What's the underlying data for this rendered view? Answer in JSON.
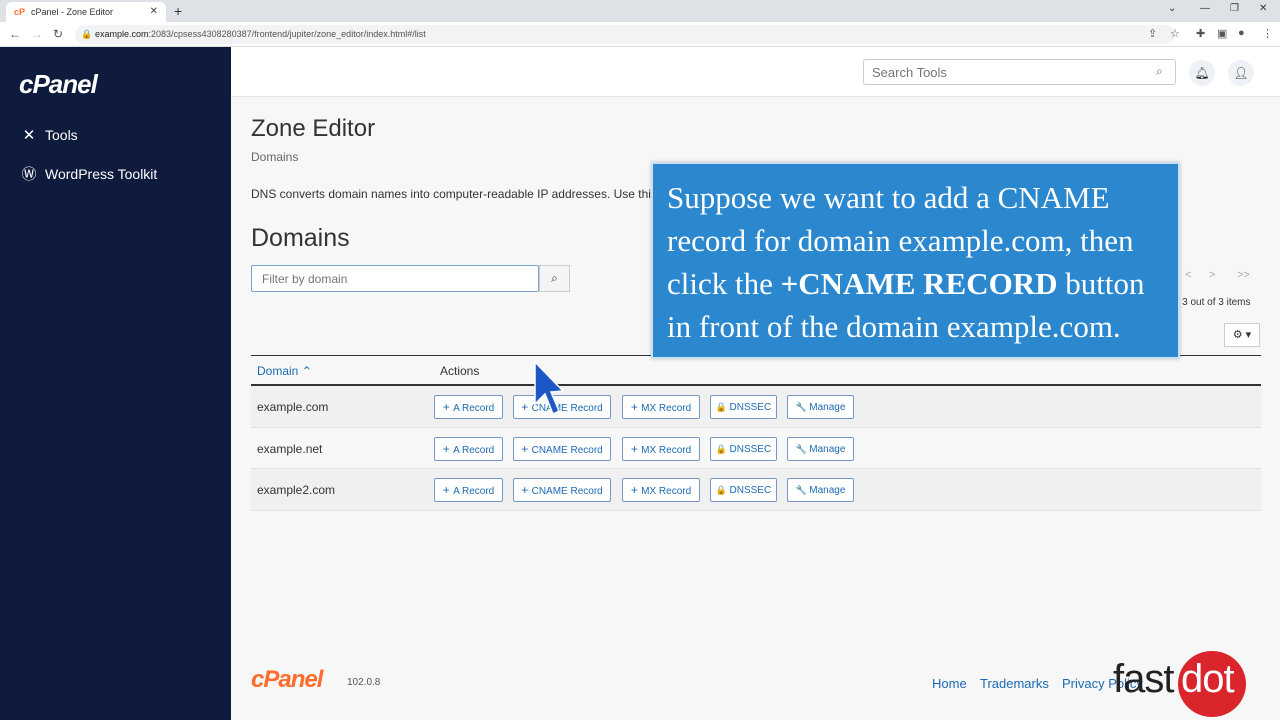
{
  "browser": {
    "tab_title": "cPanel - Zone Editor",
    "favicon": "cP",
    "url_host": "example.com",
    "url_rest": ":2083/cpsess4308280387/frontend/jupiter/zone_editor/index.html#/list"
  },
  "sidebar": {
    "logo": "cPanel",
    "items": [
      {
        "label": "Tools",
        "icon": "tools-icon"
      },
      {
        "label": "WordPress Toolkit",
        "icon": "wordpress-icon"
      }
    ]
  },
  "header": {
    "search_placeholder": "Search Tools"
  },
  "main": {
    "title": "Zone Editor",
    "breadcrumb": "Domains",
    "description": "DNS converts domain names into computer-readable IP addresses. Use this",
    "section_title": "Domains",
    "filter_placeholder": "Filter by domain",
    "pagination": {
      "prev": "<",
      "next": ">",
      "last": ">>"
    },
    "count_text": "to 3 out of 3 items",
    "table": {
      "columns": [
        "Domain",
        "Actions"
      ],
      "rows": [
        {
          "domain": "example.com"
        },
        {
          "domain": "example.net"
        },
        {
          "domain": "example2.com"
        }
      ],
      "actions": [
        "A Record",
        "CNAME Record",
        "MX Record",
        "DNSSEC",
        "Manage"
      ]
    }
  },
  "callout": {
    "line1": "Suppose we want to add a CNAME",
    "line2": "record for domain example.com, then",
    "line3a": "click the ",
    "line3b": "+CNAME RECORD",
    "line3c": " button",
    "line4": "in front of the domain example.com."
  },
  "footer": {
    "logo": "cPanel",
    "version": "102.0.8",
    "links": [
      "Home",
      "Trademarks",
      "Privacy Policy"
    ]
  },
  "watermark": {
    "text1": "fast",
    "text2": "dot"
  },
  "colors": {
    "sidebar": "#0e1b3d",
    "accent": "#1d6ab4",
    "brand": "#ff6c2c",
    "callout": "#2b88cf"
  }
}
